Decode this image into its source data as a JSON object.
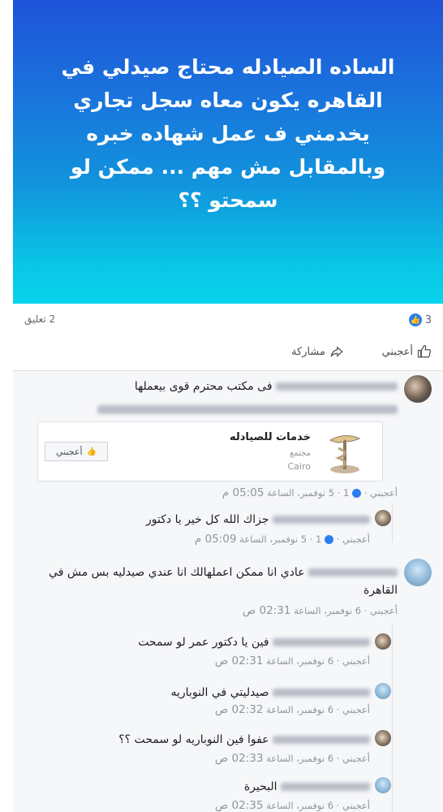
{
  "post": {
    "text": "الساده الصيادله محتاج صيدلي في القاهره يكون معاه سجل تجاري يخدمني ف عمل شهاده خبره وبالمقابل مش مهم ... ممكن لو سمحتو ؟؟",
    "like_count": "3",
    "comment_count": "2 تعليق",
    "like_action": "أعجبني",
    "share_action": "مشاركة"
  },
  "comments": [
    {
      "text": "فى مكتب محترم قوى بيعملها",
      "link": "http://www.facebook.com/khadamat.saydala",
      "meta_prefix": "أعجبني · ",
      "meta_count": "1 · 5 نوفمبر، الساعة",
      "meta_time": "05:05 م"
    },
    {
      "text": "جزاك الله كل خير يا دكتور",
      "meta_prefix": "أعجبني · ",
      "meta_count": "1 · 5 نوفمبر، الساعة",
      "meta_time": "05:09 م"
    },
    {
      "text": "عادي انا ممكن اعملهالك انا عندي صيدليه بس مش في القاهرة",
      "meta_prefix": "أعجبني · 6 نوفمبر، الساعة",
      "meta_time": "02:31 ص"
    },
    {
      "text": "فين يا دكتور عمر لو سمحت",
      "meta_prefix": "أعجبني · 6 نوفمبر، الساعة",
      "meta_time": "02:31 ص"
    },
    {
      "text": "صيدليتي في النوباريه",
      "meta_prefix": "أعجبني · 6 نوفمبر، الساعة",
      "meta_time": "02:32 ص"
    },
    {
      "text": "عفوا فين النوباريه لو سمحت ؟؟",
      "meta_prefix": "أعجبني · 6 نوفمبر، الساعة",
      "meta_time": "02:33 ص"
    },
    {
      "text": "البحيرة",
      "meta_prefix": "أعجبني · 6 نوفمبر، الساعة",
      "meta_time": "02:35 ص"
    }
  ],
  "page_card": {
    "title": "خدمات للصيادله",
    "category": "مجتمع",
    "location": "Cairo",
    "like_button": "أعجبني"
  },
  "colors": {
    "brand_blue": "#1877f2",
    "banner_top": "#1f53d9",
    "banner_bottom": "#08d4ec"
  }
}
